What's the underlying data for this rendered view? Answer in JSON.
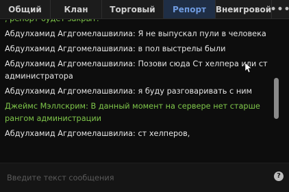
{
  "tabs": [
    {
      "label": "Общий",
      "active": false
    },
    {
      "label": "Клан",
      "active": false
    },
    {
      "label": "Торговый",
      "active": false
    },
    {
      "label": "Репорт",
      "active": true
    },
    {
      "label": "Внеигровой",
      "active": false
    }
  ],
  "more_label": "•••",
  "messages": [
    {
      "text": ", репорт будет закрыт.",
      "color": "#7fc74a"
    },
    {
      "text": "Абдулхамид Агдгомелашвилиа: Я не выпускал пули в человека",
      "color": "#e6e6e6"
    },
    {
      "text": "Абдулхамид Агдгомелашвилиа: в пол выстрелы были",
      "color": "#e6e6e6"
    },
    {
      "text": "Абдулхамид Агдгомелашвилиа: Позови сюда Ст хелпера или ст администратора",
      "color": "#e6e6e6"
    },
    {
      "text": "Абдулхамид Агдгомелашвилиа: я буду разговаривать с ним",
      "color": "#e6e6e6"
    },
    {
      "text": "Джеймс Мэллскрим: В данный момент на сервере нет старше рангом администрации",
      "color": "#7fc74a"
    },
    {
      "text": "Абдулхамид Агдгомелашвилиа: ст хелперов,",
      "color": "#e6e6e6"
    }
  ],
  "input": {
    "placeholder": "Введите текст сообщения",
    "value": ""
  },
  "help_icon": "question-icon",
  "help_label": "?",
  "colors": {
    "active_tab_bg": "#1f2e45",
    "active_tab_text": "#6f9be0",
    "system_message": "#7fc74a",
    "player_message": "#e6e6e6"
  }
}
